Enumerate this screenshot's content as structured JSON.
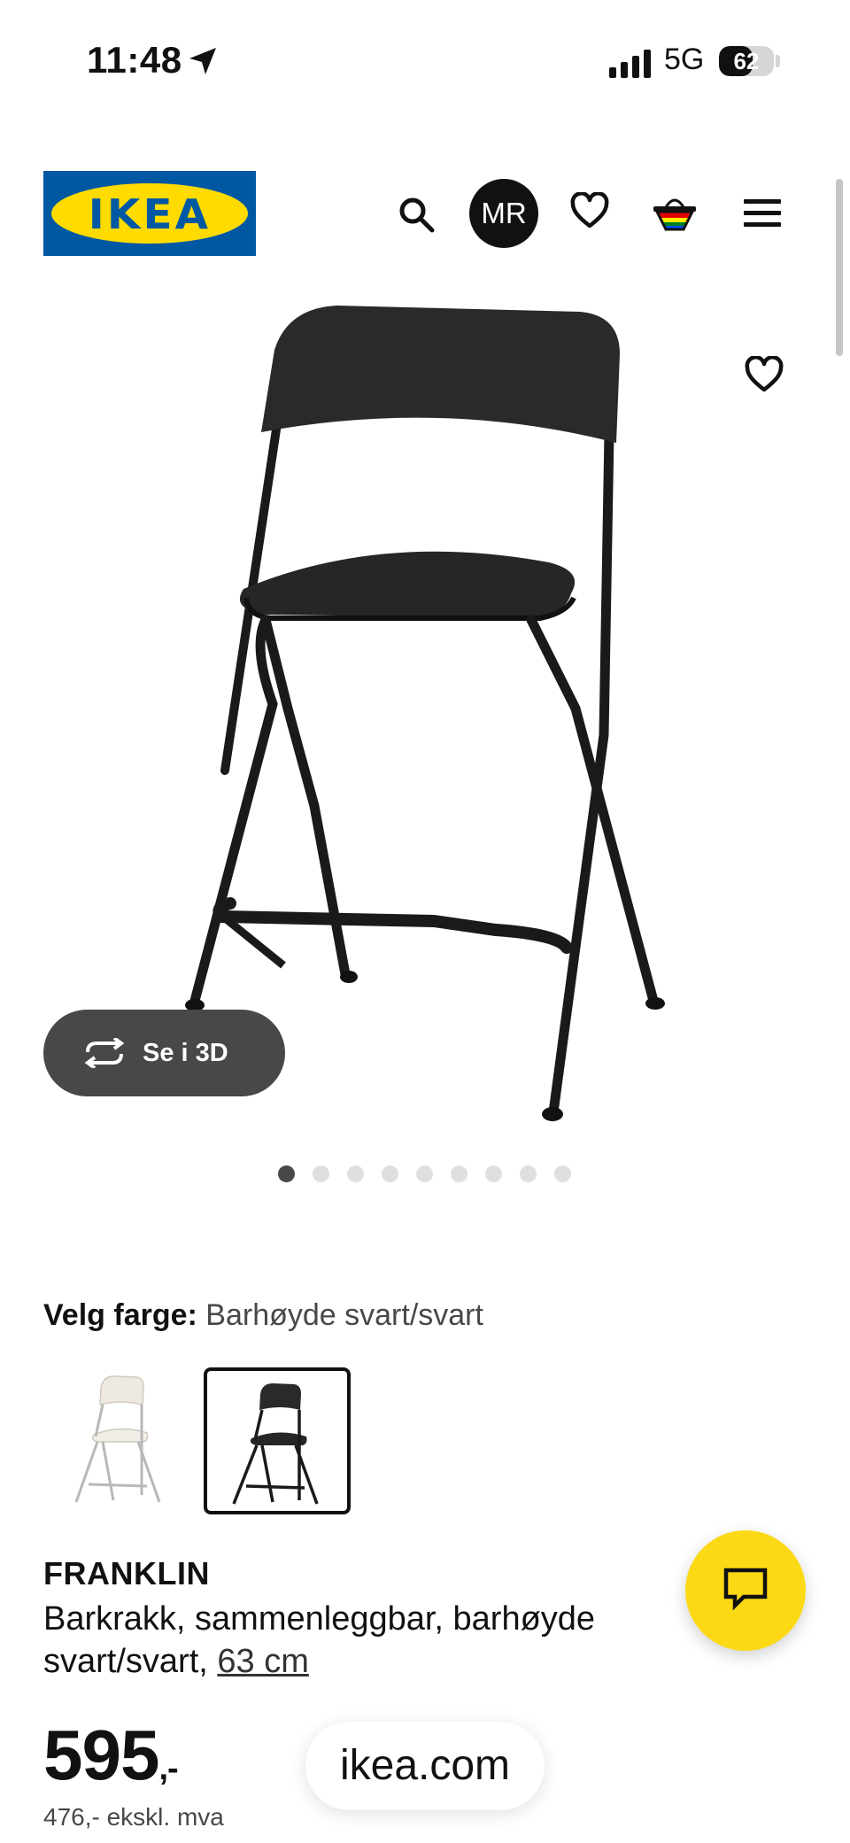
{
  "status_bar": {
    "time": "11:48",
    "network": "5G",
    "battery": "62",
    "battery_level": 0.62
  },
  "header": {
    "logo": "IKEA",
    "avatar_initials": "MR"
  },
  "gallery": {
    "view_3d_label": "Se i 3D",
    "image_count": 9,
    "active_index": 0
  },
  "color_selection": {
    "label": "Velg farge:",
    "value": "Barhøyde svart/svart",
    "options": [
      "white",
      "black"
    ],
    "selected": "black"
  },
  "product": {
    "name": "FRANKLIN",
    "description": "Barkrakk, sammenleggbar, barhøyde svart/svart, ",
    "size": "63 cm",
    "price": "595",
    "price_suffix": ",-",
    "price_ex_vat": "476,- ekskl. mva"
  },
  "browser": {
    "url": "ikea.com"
  },
  "colors": {
    "ikea_blue": "#0058a3",
    "ikea_yellow": "#ffdb00",
    "chat_yellow": "#fbd914"
  }
}
